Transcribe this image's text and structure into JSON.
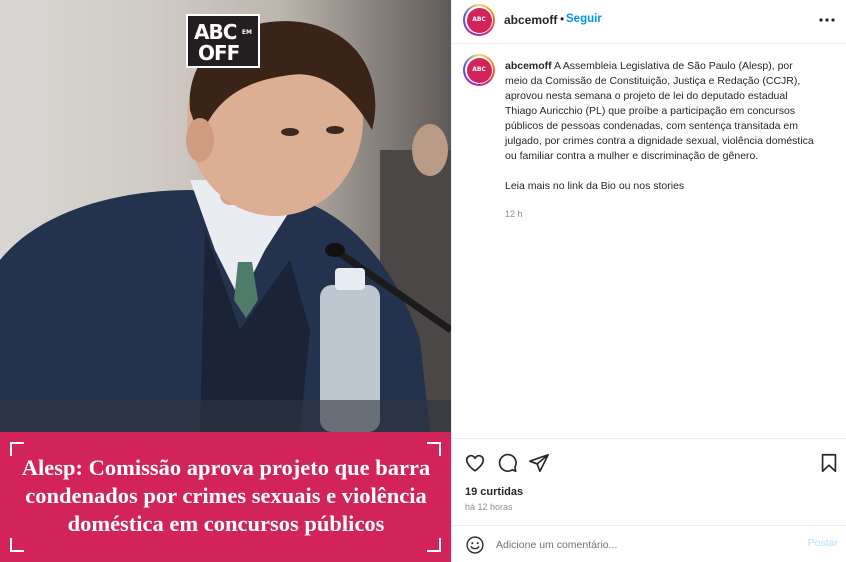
{
  "post": {
    "logo_line1": "ABC",
    "logo_line2": "OFF",
    "logo_em": "EM",
    "headline": "Alesp: Comissão aprova projeto que barra condenados por crimes sexuais e violência doméstica em concursos públicos",
    "banner_color": "#d2245a"
  },
  "header": {
    "username": "abcemoff",
    "separator": "•",
    "follow_label": "Seguir",
    "more_icon": "more-horizontal-icon"
  },
  "caption": {
    "username": "abcemoff",
    "text": "A Assembleia Legislativa de São Paulo (Alesp), por meio da Comissão de Constituição, Justiça e Redação (CCJR), aprovou nesta semana o projeto de lei do deputado estadual Thiago Auricchio (PL) que proíbe a participação em concursos públicos de pessoas condenadas, com sentença transitada em julgado, por crimes contra a dignidade sexual, violência doméstica ou familiar contra a mulher e discriminação de gênero.",
    "extra": "Leia mais no link da Bio ou nos stories",
    "time": "12 h"
  },
  "actions": {
    "likes": "19 curtidas",
    "posted_ago": "há 12 horas",
    "icons": [
      "heart-icon",
      "comment-icon",
      "share-icon",
      "bookmark-icon"
    ]
  },
  "comment": {
    "placeholder": "Adicione um comentário...",
    "post_label": "Postar",
    "emoji_icon": "emoji-icon"
  },
  "colors": {
    "accent": "#0095f6",
    "post_disabled": "#b2dffc",
    "brand_pink": "#d2245a"
  }
}
